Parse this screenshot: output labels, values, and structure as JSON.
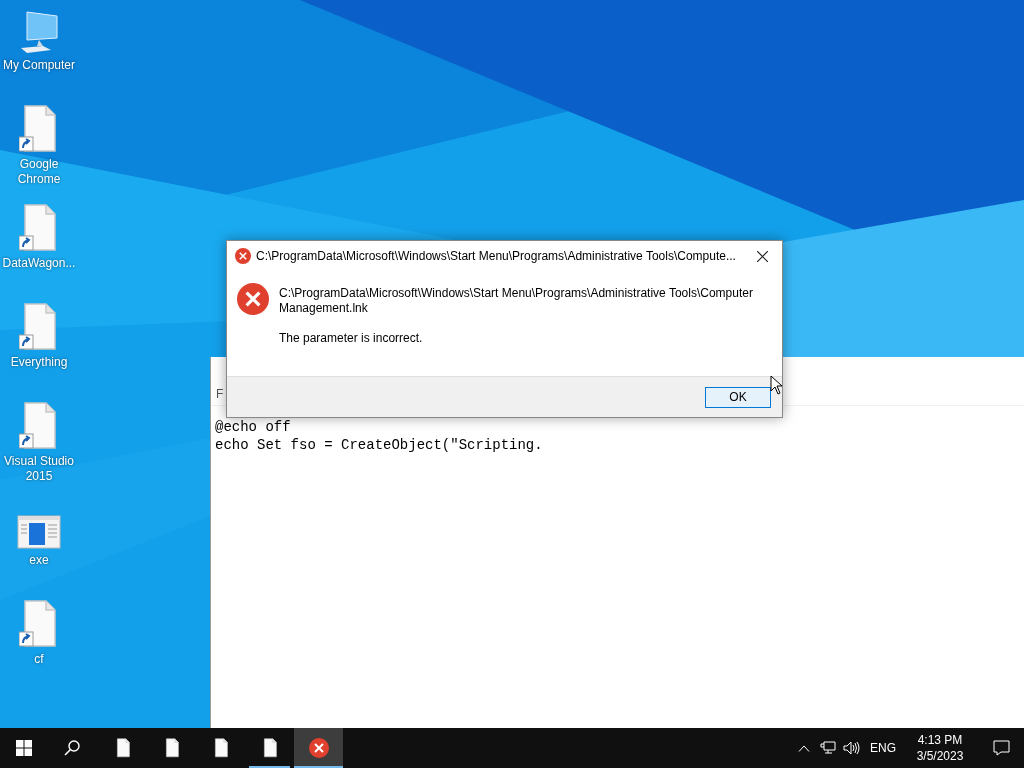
{
  "desktop_icons": [
    {
      "label": "My Computer",
      "kind": "computer"
    },
    {
      "label": "Google Chrome",
      "kind": "shortcut"
    },
    {
      "label": "DataWagon...",
      "kind": "shortcut"
    },
    {
      "label": "Everything",
      "kind": "shortcut"
    },
    {
      "label": "Visual Studio 2015",
      "kind": "shortcut"
    },
    {
      "label": "exe",
      "kind": "window"
    },
    {
      "label": "cf",
      "kind": "shortcut"
    }
  ],
  "editor": {
    "menu": "F",
    "lines": [
      "@echo off",
      "echo Set fso = CreateObject(\"Scripting."
    ]
  },
  "dialog": {
    "title": "C:\\ProgramData\\Microsoft\\Windows\\Start Menu\\Programs\\Administrative Tools\\Compute...",
    "path": "C:\\ProgramData\\Microsoft\\Windows\\Start Menu\\Programs\\Administrative Tools\\Computer Management.lnk",
    "message": "The parameter is incorrect.",
    "ok": "OK"
  },
  "taskbar": {
    "apps": [
      {
        "kind": "file",
        "running": false,
        "selected": false
      },
      {
        "kind": "file",
        "running": false,
        "selected": false
      },
      {
        "kind": "file",
        "running": false,
        "selected": false
      },
      {
        "kind": "file",
        "running": true,
        "selected": false
      },
      {
        "kind": "error",
        "running": true,
        "selected": true
      }
    ],
    "language": "ENG",
    "time": "4:13 PM",
    "date": "3/5/2023"
  }
}
